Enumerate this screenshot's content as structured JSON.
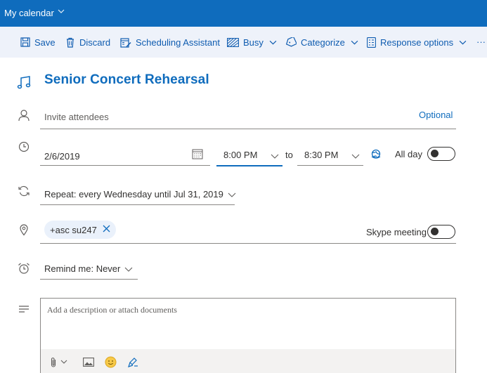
{
  "topbar": {
    "title": "My calendar"
  },
  "toolbar": {
    "save": "Save",
    "discard": "Discard",
    "scheduling": "Scheduling Assistant",
    "busy": "Busy",
    "categorize": "Categorize",
    "response": "Response options",
    "more": "···"
  },
  "event": {
    "title": "Senior Concert Rehearsal"
  },
  "attendees": {
    "placeholder": "Invite attendees",
    "optional": "Optional"
  },
  "time": {
    "date": "2/6/2019",
    "start": "8:00 PM",
    "to": "to",
    "end": "8:30 PM",
    "allday": "All day",
    "allday_on": false
  },
  "repeat": {
    "label": "Repeat: every Wednesday until Jul 31, 2019"
  },
  "location": {
    "pill": "+asc su247",
    "skype": "Skype meeting",
    "skype_on": false
  },
  "reminder": {
    "label": "Remind me: Never"
  },
  "description": {
    "placeholder": "Add a description or attach documents"
  },
  "colors": {
    "accent": "#0f6cbd",
    "toolbar_bg": "#eef2fa",
    "pill_bg": "#eaf1fb"
  },
  "icons": [
    "music-note-icon",
    "person-icon",
    "clock-icon",
    "repeat-icon",
    "location-pin-icon",
    "alarm-clock-icon",
    "description-lines-icon"
  ]
}
